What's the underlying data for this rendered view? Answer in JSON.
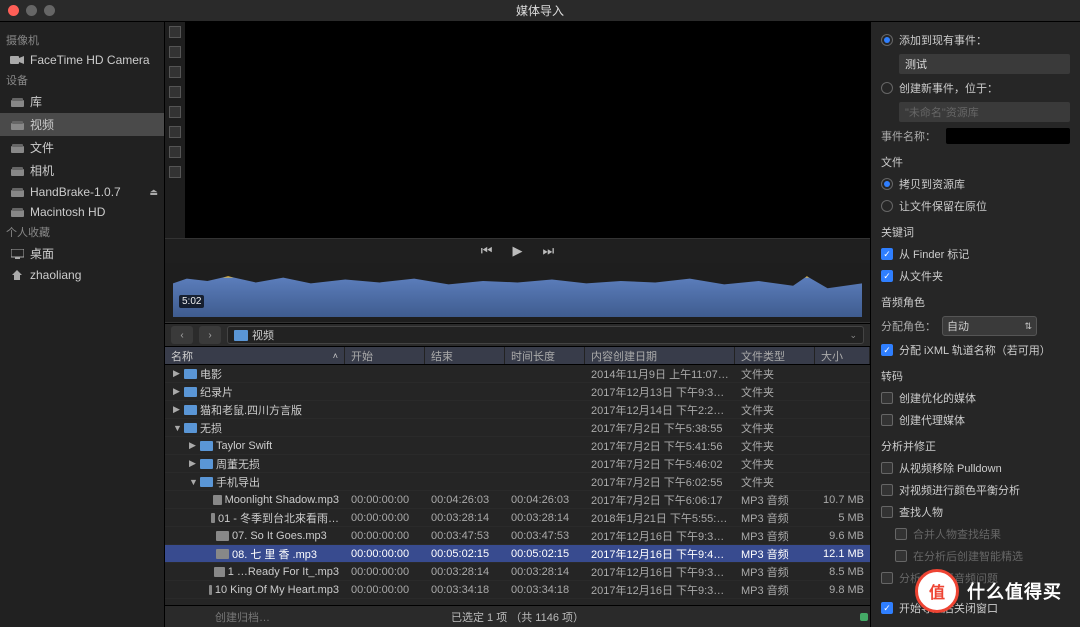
{
  "window": {
    "title": "媒体导入"
  },
  "traffic": {
    "close": "#ff5f57",
    "min": "#666",
    "max": "#666"
  },
  "sidebar": {
    "sections": [
      {
        "head": "摄像机",
        "items": [
          {
            "label": "FaceTime HD Camera",
            "icon": "camcorder"
          }
        ]
      },
      {
        "head": "设备",
        "items": [
          {
            "label": "库",
            "icon": "tray"
          },
          {
            "label": "视频",
            "icon": "tray",
            "selected": true
          },
          {
            "label": "文件",
            "icon": "tray"
          },
          {
            "label": "相机",
            "icon": "tray"
          },
          {
            "label": "HandBrake-1.0.7",
            "icon": "tray",
            "eject": true
          },
          {
            "label": "Macintosh HD",
            "icon": "tray"
          }
        ]
      },
      {
        "head": "个人收藏",
        "items": [
          {
            "label": "桌面",
            "icon": "desktop"
          },
          {
            "label": "zhaoliang",
            "icon": "home"
          }
        ]
      }
    ]
  },
  "player": {
    "time": "5:02"
  },
  "pathbar": {
    "folder": "视频"
  },
  "table": {
    "headers": {
      "name": "名称",
      "start": "开始",
      "end": "结束",
      "duration": "时间长度",
      "created": "内容创建日期",
      "type": "文件类型",
      "size": "大小"
    },
    "rows": [
      {
        "indent": 0,
        "disc": "▶",
        "icon": "folder",
        "name": "电影",
        "created": "2014年11月9日 上午11:07:…",
        "type": "文件夹"
      },
      {
        "indent": 0,
        "disc": "▶",
        "icon": "folder",
        "name": "纪录片",
        "created": "2017年12月13日 下午9:30:…",
        "type": "文件夹"
      },
      {
        "indent": 0,
        "disc": "▶",
        "icon": "folder",
        "name": "猫和老鼠.四川方言版",
        "created": "2017年12月14日 下午2:28:…",
        "type": "文件夹"
      },
      {
        "indent": 0,
        "disc": "▼",
        "icon": "folder",
        "name": "无损",
        "created": "2017年7月2日 下午5:38:55",
        "type": "文件夹"
      },
      {
        "indent": 1,
        "disc": "▶",
        "icon": "folder",
        "name": "Taylor Swift",
        "created": "2017年7月2日 下午5:41:56",
        "type": "文件夹"
      },
      {
        "indent": 1,
        "disc": "▶",
        "icon": "folder",
        "name": "周董无损",
        "created": "2017年7月2日 下午5:46:02",
        "type": "文件夹"
      },
      {
        "indent": 1,
        "disc": "▼",
        "icon": "folder",
        "name": "手机导出",
        "created": "2017年7月2日 下午6:02:55",
        "type": "文件夹"
      },
      {
        "indent": 2,
        "icon": "file",
        "name": "Moonlight Shadow.mp3",
        "start": "00:00:00:00",
        "end": "00:04:26:03",
        "duration": "00:04:26:03",
        "created": "2017年7月2日 下午6:06:17",
        "type": "MP3 音频",
        "size": "10.7 MB"
      },
      {
        "indent": 2,
        "icon": "file",
        "name": "01 - 冬季到台北來看雨…",
        "start": "00:00:00:00",
        "end": "00:03:28:14",
        "duration": "00:03:28:14",
        "created": "2018年1月21日 下午5:55:1…",
        "type": "MP3 音频",
        "size": "5 MB"
      },
      {
        "indent": 2,
        "icon": "file",
        "name": "07. So It Goes.mp3",
        "start": "00:00:00:00",
        "end": "00:03:47:53",
        "duration": "00:03:47:53",
        "created": "2017年12月16日 下午9:35:…",
        "type": "MP3 音频",
        "size": "9.6 MB"
      },
      {
        "indent": 2,
        "icon": "file",
        "name": "08. 七 里 香 .mp3",
        "start": "00:00:00:00",
        "end": "00:05:02:15",
        "duration": "00:05:02:15",
        "created": "2017年12月16日 下午9:44:…",
        "type": "MP3 音频",
        "size": "12.1 MB",
        "selected": true
      },
      {
        "indent": 2,
        "icon": "file",
        "name": "1 …Ready For It_.mp3",
        "start": "00:00:00:00",
        "end": "00:03:28:14",
        "duration": "00:03:28:14",
        "created": "2017年12月16日 下午9:35:…",
        "type": "MP3 音频",
        "size": "8.5 MB"
      },
      {
        "indent": 2,
        "icon": "file",
        "name": "10 King Of My Heart.mp3",
        "start": "00:00:00:00",
        "end": "00:03:34:18",
        "duration": "00:03:34:18",
        "created": "2017年12月16日 下午9:35:…",
        "type": "MP3 音频",
        "size": "9.8 MB"
      }
    ]
  },
  "status": {
    "left_btn": "创建归档…",
    "text": "已选定 1 项 （共 1146 项）"
  },
  "rpanel": {
    "add_existing": "添加到现有事件：",
    "existing_value": "测试",
    "create_new": "创建新事件，位于：",
    "new_hint": "\"未命名\"资源库",
    "event_name_label": "事件名称：",
    "files_heading": "文件",
    "copy_to_lib": "拷贝到资源库",
    "leave_in_place": "让文件保留在原位",
    "keywords_heading": "关键词",
    "from_finder": "从 Finder 标记",
    "from_folder": "从文件夹",
    "audio_role_heading": "音频角色",
    "assign_role_label": "分配角色：",
    "assign_role_value": "自动",
    "assign_ixml": "分配 iXML 轨道名称（若可用）",
    "transcode_heading": "转码",
    "create_optimized": "创建优化的媒体",
    "create_proxy": "创建代理媒体",
    "analyze_heading": "分析并修正",
    "remove_pulldown": "从视频移除 Pulldown",
    "color_balance": "对视频进行颜色平衡分析",
    "find_people": "查找人物",
    "consolidate_find": "合并人物查找结果",
    "smart_collections": "在分析后创建智能精选",
    "audio_analysis": "分析并修正音频问题",
    "close_after_import": "开始导入后关闭窗口"
  },
  "watermark": {
    "char": "值",
    "text": "什么值得买"
  }
}
